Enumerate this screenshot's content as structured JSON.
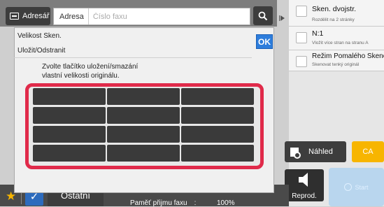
{
  "topbar": {
    "address_book_label": "Adresář",
    "address_label": "Adresa",
    "fax_placeholder": "Číslo faxu"
  },
  "dialog": {
    "title": "Velikost Sken.",
    "subtitle": "Uložit/Odstranit",
    "ok_label": "OK",
    "instruction_line1": "Zvolte tlačítko uložení/smazání",
    "instruction_line2": "vlastní velikosti originálu.",
    "size_buttons": [
      "",
      "",
      "",
      "",
      "",
      "",
      "",
      "",
      "",
      "",
      "",
      ""
    ]
  },
  "options": [
    {
      "title": "Sken. dvojstr.",
      "desc": "Rozdělit na 2 stránky"
    },
    {
      "title": "N:1",
      "desc": "Vložit více stran na stranu A"
    },
    {
      "title": "Režim Pomalého Skenování",
      "desc": "Skenovat tenký originál"
    }
  ],
  "actions": {
    "preview_label": "Náhled",
    "ca_label": "CA",
    "reprod_label": "Reprod.",
    "start_label": "Start"
  },
  "bottombar": {
    "other_label": "Ostatní",
    "fax_memory_label": "Paměť přijmu faxu",
    "fax_memory_sep": ":",
    "fax_memory_value": "100%"
  },
  "colors": {
    "accent_red": "#e02a4a",
    "ok_blue": "#2d7ddc",
    "ca_yellow": "#f7b500"
  }
}
